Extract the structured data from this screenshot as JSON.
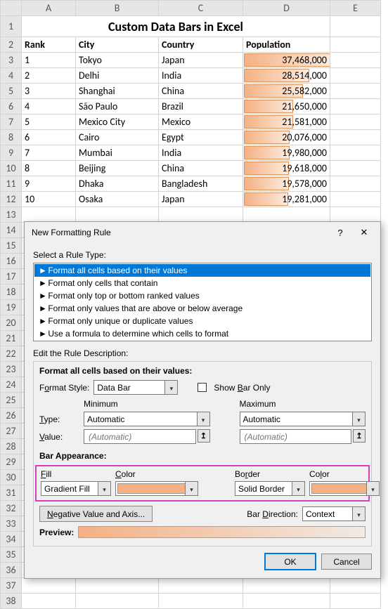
{
  "sheet": {
    "title": "Custom Data Bars in Excel",
    "col_headers": [
      "A",
      "B",
      "C",
      "D",
      "E"
    ],
    "row_headers": [
      1,
      2,
      3,
      4,
      5,
      6,
      7,
      8,
      9,
      10,
      11,
      12,
      13,
      14,
      15,
      16,
      17,
      18,
      19,
      20,
      21,
      22,
      23,
      24,
      25,
      26,
      27,
      28,
      29,
      30,
      31,
      32,
      33,
      34,
      35,
      36,
      37,
      38
    ],
    "headers": {
      "rank": "Rank",
      "city": "City",
      "country": "Country",
      "population": "Population"
    },
    "data": [
      {
        "rank": "1",
        "city": "Tokyo",
        "country": "Japan",
        "pop": "37,468,000",
        "pct": 100
      },
      {
        "rank": "2",
        "city": "Delhi",
        "country": "India",
        "pop": "28,514,000",
        "pct": 76
      },
      {
        "rank": "3",
        "city": "Shanghai",
        "country": "China",
        "pop": "25,582,000",
        "pct": 68
      },
      {
        "rank": "4",
        "city": "São Paulo",
        "country": "Brazil",
        "pop": "21,650,000",
        "pct": 57
      },
      {
        "rank": "5",
        "city": "Mexico City",
        "country": "Mexico",
        "pop": "21,581,000",
        "pct": 57
      },
      {
        "rank": "6",
        "city": "Cairo",
        "country": "Egypt",
        "pop": "20,076,000",
        "pct": 53
      },
      {
        "rank": "7",
        "city": "Mumbai",
        "country": "India",
        "pop": "19,980,000",
        "pct": 53
      },
      {
        "rank": "8",
        "city": "Beijing",
        "country": "China",
        "pop": "19,618,000",
        "pct": 52
      },
      {
        "rank": "9",
        "city": "Dhaka",
        "country": "Bangladesh",
        "pop": "19,578,000",
        "pct": 52
      },
      {
        "rank": "10",
        "city": "Osaka",
        "country": "Japan",
        "pop": "19,281,000",
        "pct": 51
      }
    ]
  },
  "dialog": {
    "title": "New Formatting Rule",
    "select_label": "Select a Rule Type:",
    "rule_types": [
      "Format all cells based on their values",
      "Format only cells that contain",
      "Format only top or bottom ranked values",
      "Format only values that are above or below average",
      "Format only unique or duplicate values",
      "Use a formula to determine which cells to format"
    ],
    "edit_label": "Edit the Rule Description:",
    "desc_title": "Format all cells based on their values:",
    "format_style_label": "Format Style:",
    "format_style_value": "Data Bar",
    "show_bar_only": "Show Bar Only",
    "minimum": "Minimum",
    "maximum": "Maximum",
    "type_label": "Type:",
    "type_value": "Automatic",
    "value_label": "Value:",
    "value_placeholder": "(Automatic)",
    "bar_appearance": "Bar Appearance:",
    "fill_label": "Fill",
    "fill_value": "Gradient Fill",
    "color_label": "Color",
    "border_label": "Border",
    "border_value": "Solid Border",
    "neg_button": "Negative Value and Axis...",
    "bar_dir_label": "Bar Direction:",
    "bar_dir_value": "Context",
    "preview_label": "Preview:",
    "ok": "OK",
    "cancel": "Cancel",
    "colors": {
      "fill": "#f4b183",
      "border": "#f4b183"
    }
  }
}
